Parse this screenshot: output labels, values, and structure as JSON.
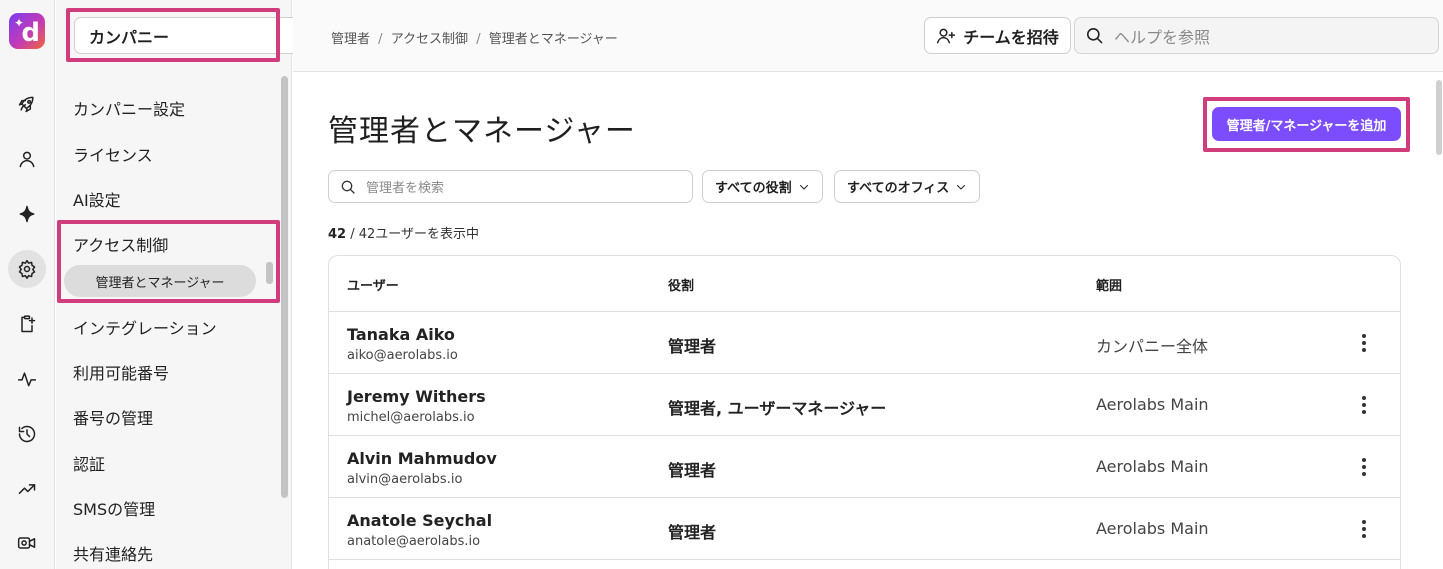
{
  "app": {
    "logo_letter": "d",
    "logo_spark": "✦"
  },
  "rail": {
    "icons": [
      "rocket-icon",
      "person-icon",
      "sparkle-icon",
      "gear-icon",
      "clipboard-add-icon",
      "activity-icon",
      "history-icon",
      "trending-icon",
      "video-icon"
    ],
    "active_icon": "gear-icon"
  },
  "sidebar": {
    "company_select": "カンパニー",
    "items": [
      {
        "label": "カンパニー設定"
      },
      {
        "label": "ライセンス"
      },
      {
        "label": "AI設定"
      },
      {
        "label": "アクセス制御"
      },
      {
        "label": "インテグレーション"
      },
      {
        "label": "利用可能番号"
      },
      {
        "label": "番号の管理"
      },
      {
        "label": "認証"
      },
      {
        "label": "SMSの管理"
      },
      {
        "label": "共有連絡先"
      }
    ],
    "active_subitem": "管理者とマネージャー"
  },
  "header": {
    "breadcrumb": [
      "管理者",
      "アクセス制御",
      "管理者とマネージャー"
    ],
    "breadcrumb_sep": "/",
    "invite_label": "チームを招待",
    "help_placeholder": "ヘルプを参照"
  },
  "main": {
    "title": "管理者とマネージャー",
    "add_button": "管理者/マネージャーを追加",
    "search_placeholder": "管理者を検索",
    "filter_roles": "すべての役割",
    "filter_offices": "すべてのオフィス",
    "count_shown": "42",
    "count_suffix": " / 42ユーザーを表示中",
    "columns": {
      "user": "ユーザー",
      "role": "役割",
      "scope": "範囲"
    },
    "rows": [
      {
        "name": "Tanaka Aiko",
        "email": "aiko@aerolabs.io",
        "role": "管理者",
        "scope": "カンパニー全体"
      },
      {
        "name": "Jeremy Withers",
        "email": "michel@aerolabs.io",
        "role": "管理者, ユーザーマネージャー",
        "scope": "Aerolabs Main"
      },
      {
        "name": "Alvin Mahmudov",
        "email": "alvin@aerolabs.io",
        "role": "管理者",
        "scope": "Aerolabs Main"
      },
      {
        "name": "Anatole Seychal",
        "email": "anatole@aerolabs.io",
        "role": "管理者",
        "scope": "Aerolabs Main"
      }
    ]
  },
  "colors": {
    "accent": "#7c4dff",
    "highlight": "#d13d7c"
  }
}
